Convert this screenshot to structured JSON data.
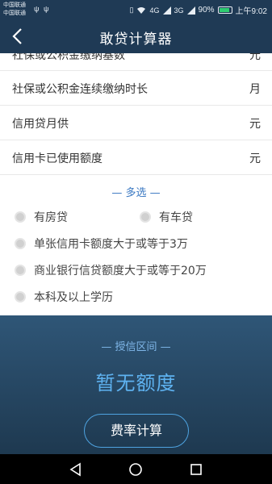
{
  "status_bar": {
    "carrier_1": "中国联通",
    "carrier_2": "中国联通",
    "battery_percent": "90%",
    "time": "上午9:02",
    "net_1": "4G",
    "net_2": "3G"
  },
  "header": {
    "title": "敢贷计算器"
  },
  "rows": [
    {
      "label": "社保或公积金缴纳基数",
      "unit": "元"
    },
    {
      "label": "社保或公积金连续缴纳时长",
      "unit": "月"
    },
    {
      "label": "信用贷月供",
      "unit": "元"
    },
    {
      "label": "信用卡已使用额度",
      "unit": "元"
    }
  ],
  "multi_select": {
    "header": "— 多选 —",
    "options": [
      {
        "label": "有房贷",
        "checked": false
      },
      {
        "label": "有车贷",
        "checked": false
      },
      {
        "label": "单张信用卡额度大于或等于3万",
        "checked": false
      },
      {
        "label": "商业银行信贷额度大于或等于20万",
        "checked": false
      },
      {
        "label": "本科及以上学历",
        "checked": false
      }
    ]
  },
  "result": {
    "range_label": "— 授信区间 —",
    "quota_text": "暂无额度",
    "button_label": "费率计算"
  },
  "colors": {
    "header_bg": "#1f3a55",
    "accent": "#3a78c2",
    "quota": "#5eb2f0"
  }
}
